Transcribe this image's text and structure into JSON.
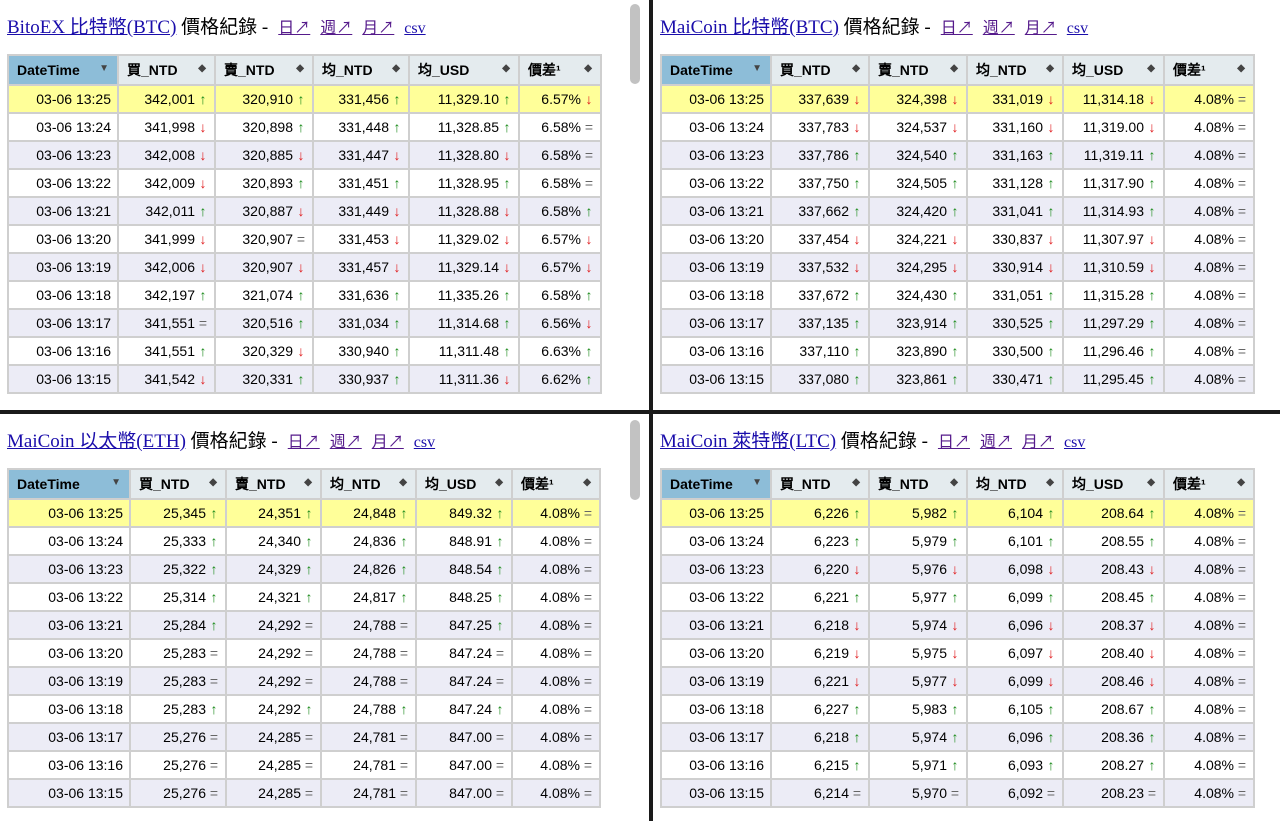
{
  "links": {
    "day": "日↗",
    "week": "週↗",
    "month": "月↗",
    "csv": "csv"
  },
  "headers": [
    "DateTime",
    "買_NTD",
    "賣_NTD",
    "均_NTD",
    "均_USD",
    "價差¹"
  ],
  "colors": {
    "up": "#1a8a1a",
    "down": "#e0191b",
    "highlight": "#ffff99",
    "sorted_header": "#8dbdd8"
  },
  "panels": [
    {
      "exchange": "BitoEX 比特幣(BTC)",
      "suffix": "價格紀錄 -",
      "rows": [
        [
          "03-06 13:25",
          "342,001",
          "↑",
          "320,910",
          "↑",
          "331,456",
          "↑",
          "11,329.10",
          "↑",
          "6.57%",
          "↓"
        ],
        [
          "03-06 13:24",
          "341,998",
          "↓",
          "320,898",
          "↑",
          "331,448",
          "↑",
          "11,328.85",
          "↑",
          "6.58%",
          "="
        ],
        [
          "03-06 13:23",
          "342,008",
          "↓",
          "320,885",
          "↓",
          "331,447",
          "↓",
          "11,328.80",
          "↓",
          "6.58%",
          "="
        ],
        [
          "03-06 13:22",
          "342,009",
          "↓",
          "320,893",
          "↑",
          "331,451",
          "↑",
          "11,328.95",
          "↑",
          "6.58%",
          "="
        ],
        [
          "03-06 13:21",
          "342,011",
          "↑",
          "320,887",
          "↓",
          "331,449",
          "↓",
          "11,328.88",
          "↓",
          "6.58%",
          "↑"
        ],
        [
          "03-06 13:20",
          "341,999",
          "↓",
          "320,907",
          "=",
          "331,453",
          "↓",
          "11,329.02",
          "↓",
          "6.57%",
          "↓"
        ],
        [
          "03-06 13:19",
          "342,006",
          "↓",
          "320,907",
          "↓",
          "331,457",
          "↓",
          "11,329.14",
          "↓",
          "6.57%",
          "↓"
        ],
        [
          "03-06 13:18",
          "342,197",
          "↑",
          "321,074",
          "↑",
          "331,636",
          "↑",
          "11,335.26",
          "↑",
          "6.58%",
          "↑"
        ],
        [
          "03-06 13:17",
          "341,551",
          "=",
          "320,516",
          "↑",
          "331,034",
          "↑",
          "11,314.68",
          "↑",
          "6.56%",
          "↓"
        ],
        [
          "03-06 13:16",
          "341,551",
          "↑",
          "320,329",
          "↓",
          "330,940",
          "↑",
          "11,311.48",
          "↑",
          "6.63%",
          "↑"
        ],
        [
          "03-06 13:15",
          "341,542",
          "↓",
          "320,331",
          "↑",
          "330,937",
          "↑",
          "11,311.36",
          "↓",
          "6.62%",
          "↑"
        ]
      ]
    },
    {
      "exchange": "MaiCoin 比特幣(BTC)",
      "suffix": "價格紀錄 -",
      "rows": [
        [
          "03-06 13:25",
          "337,639",
          "↓",
          "324,398",
          "↓",
          "331,019",
          "↓",
          "11,314.18",
          "↓",
          "4.08%",
          "="
        ],
        [
          "03-06 13:24",
          "337,783",
          "↓",
          "324,537",
          "↓",
          "331,160",
          "↓",
          "11,319.00",
          "↓",
          "4.08%",
          "="
        ],
        [
          "03-06 13:23",
          "337,786",
          "↑",
          "324,540",
          "↑",
          "331,163",
          "↑",
          "11,319.11",
          "↑",
          "4.08%",
          "="
        ],
        [
          "03-06 13:22",
          "337,750",
          "↑",
          "324,505",
          "↑",
          "331,128",
          "↑",
          "11,317.90",
          "↑",
          "4.08%",
          "="
        ],
        [
          "03-06 13:21",
          "337,662",
          "↑",
          "324,420",
          "↑",
          "331,041",
          "↑",
          "11,314.93",
          "↑",
          "4.08%",
          "="
        ],
        [
          "03-06 13:20",
          "337,454",
          "↓",
          "324,221",
          "↓",
          "330,837",
          "↓",
          "11,307.97",
          "↓",
          "4.08%",
          "="
        ],
        [
          "03-06 13:19",
          "337,532",
          "↓",
          "324,295",
          "↓",
          "330,914",
          "↓",
          "11,310.59",
          "↓",
          "4.08%",
          "="
        ],
        [
          "03-06 13:18",
          "337,672",
          "↑",
          "324,430",
          "↑",
          "331,051",
          "↑",
          "11,315.28",
          "↑",
          "4.08%",
          "="
        ],
        [
          "03-06 13:17",
          "337,135",
          "↑",
          "323,914",
          "↑",
          "330,525",
          "↑",
          "11,297.29",
          "↑",
          "4.08%",
          "="
        ],
        [
          "03-06 13:16",
          "337,110",
          "↑",
          "323,890",
          "↑",
          "330,500",
          "↑",
          "11,296.46",
          "↑",
          "4.08%",
          "="
        ],
        [
          "03-06 13:15",
          "337,080",
          "↑",
          "323,861",
          "↑",
          "330,471",
          "↑",
          "11,295.45",
          "↑",
          "4.08%",
          "="
        ]
      ]
    },
    {
      "exchange": "MaiCoin 以太幣(ETH)",
      "suffix": "價格紀錄 -",
      "rows": [
        [
          "03-06 13:25",
          "25,345",
          "↑",
          "24,351",
          "↑",
          "24,848",
          "↑",
          "849.32",
          "↑",
          "4.08%",
          "="
        ],
        [
          "03-06 13:24",
          "25,333",
          "↑",
          "24,340",
          "↑",
          "24,836",
          "↑",
          "848.91",
          "↑",
          "4.08%",
          "="
        ],
        [
          "03-06 13:23",
          "25,322",
          "↑",
          "24,329",
          "↑",
          "24,826",
          "↑",
          "848.54",
          "↑",
          "4.08%",
          "="
        ],
        [
          "03-06 13:22",
          "25,314",
          "↑",
          "24,321",
          "↑",
          "24,817",
          "↑",
          "848.25",
          "↑",
          "4.08%",
          "="
        ],
        [
          "03-06 13:21",
          "25,284",
          "↑",
          "24,292",
          "=",
          "24,788",
          "=",
          "847.25",
          "↑",
          "4.08%",
          "="
        ],
        [
          "03-06 13:20",
          "25,283",
          "=",
          "24,292",
          "=",
          "24,788",
          "=",
          "847.24",
          "=",
          "4.08%",
          "="
        ],
        [
          "03-06 13:19",
          "25,283",
          "=",
          "24,292",
          "=",
          "24,788",
          "=",
          "847.24",
          "=",
          "4.08%",
          "="
        ],
        [
          "03-06 13:18",
          "25,283",
          "↑",
          "24,292",
          "↑",
          "24,788",
          "↑",
          "847.24",
          "↑",
          "4.08%",
          "="
        ],
        [
          "03-06 13:17",
          "25,276",
          "=",
          "24,285",
          "=",
          "24,781",
          "=",
          "847.00",
          "=",
          "4.08%",
          "="
        ],
        [
          "03-06 13:16",
          "25,276",
          "=",
          "24,285",
          "=",
          "24,781",
          "=",
          "847.00",
          "=",
          "4.08%",
          "="
        ],
        [
          "03-06 13:15",
          "25,276",
          "=",
          "24,285",
          "=",
          "24,781",
          "=",
          "847.00",
          "=",
          "4.08%",
          "="
        ]
      ]
    },
    {
      "exchange": "MaiCoin 萊特幣(LTC)",
      "suffix": "價格紀錄 -",
      "rows": [
        [
          "03-06 13:25",
          "6,226",
          "↑",
          "5,982",
          "↑",
          "6,104",
          "↑",
          "208.64",
          "↑",
          "4.08%",
          "="
        ],
        [
          "03-06 13:24",
          "6,223",
          "↑",
          "5,979",
          "↑",
          "6,101",
          "↑",
          "208.55",
          "↑",
          "4.08%",
          "="
        ],
        [
          "03-06 13:23",
          "6,220",
          "↓",
          "5,976",
          "↓",
          "6,098",
          "↓",
          "208.43",
          "↓",
          "4.08%",
          "="
        ],
        [
          "03-06 13:22",
          "6,221",
          "↑",
          "5,977",
          "↑",
          "6,099",
          "↑",
          "208.45",
          "↑",
          "4.08%",
          "="
        ],
        [
          "03-06 13:21",
          "6,218",
          "↓",
          "5,974",
          "↓",
          "6,096",
          "↓",
          "208.37",
          "↓",
          "4.08%",
          "="
        ],
        [
          "03-06 13:20",
          "6,219",
          "↓",
          "5,975",
          "↓",
          "6,097",
          "↓",
          "208.40",
          "↓",
          "4.08%",
          "="
        ],
        [
          "03-06 13:19",
          "6,221",
          "↓",
          "5,977",
          "↓",
          "6,099",
          "↓",
          "208.46",
          "↓",
          "4.08%",
          "="
        ],
        [
          "03-06 13:18",
          "6,227",
          "↑",
          "5,983",
          "↑",
          "6,105",
          "↑",
          "208.67",
          "↑",
          "4.08%",
          "="
        ],
        [
          "03-06 13:17",
          "6,218",
          "↑",
          "5,974",
          "↑",
          "6,096",
          "↑",
          "208.36",
          "↑",
          "4.08%",
          "="
        ],
        [
          "03-06 13:16",
          "6,215",
          "↑",
          "5,971",
          "↑",
          "6,093",
          "↑",
          "208.27",
          "↑",
          "4.08%",
          "="
        ],
        [
          "03-06 13:15",
          "6,214",
          "=",
          "5,970",
          "=",
          "6,092",
          "=",
          "208.23",
          "=",
          "4.08%",
          "="
        ]
      ]
    }
  ]
}
